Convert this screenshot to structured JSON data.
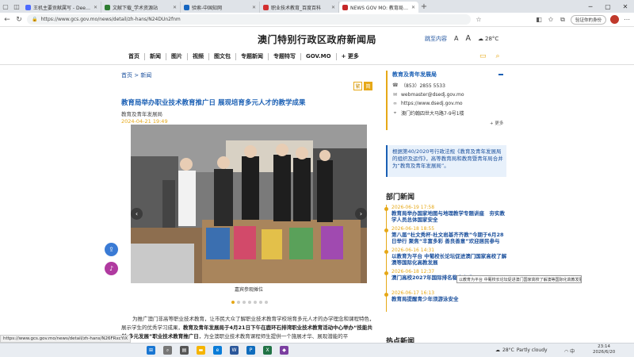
{
  "browser": {
    "tabs": [
      {
        "title": "王机主要贡献属写 - DeepSeek",
        "color": "#4d6bfe",
        "active": false
      },
      {
        "title": "文献下载_学术资源站",
        "color": "#2e7d32",
        "active": false
      },
      {
        "title": "验索-中国知网",
        "color": "#1565c0",
        "active": false
      },
      {
        "title": "职业技术教育_百度百科",
        "color": "#d32f2f",
        "active": false
      },
      {
        "title": "NEWS GOV MO: 教育局举办职业技术教育推广日",
        "color": "#c62828",
        "active": true
      }
    ],
    "url": "https://www.gcs.gov.mo/news/detail/zh-hans/N24DUn2fnm",
    "profile_label": "验证你的身份",
    "status_url": "https://www.gcs.gov.mo/news/detail/zh-hans/N26FRxcYiX"
  },
  "site": {
    "title": "澳门特别行政区政府新闻局",
    "skip_label": "跳至内容",
    "font_small": "A",
    "font_large": "A",
    "weather": "28°C"
  },
  "nav": {
    "items": [
      "首页",
      "新闻",
      "图片",
      "视频",
      "图文包",
      "专题新闻",
      "专题特写",
      "GOV.MO",
      "+ 更多"
    ]
  },
  "breadcrumb": {
    "home": "首页",
    "sep": ">",
    "current": "新闻"
  },
  "lang": {
    "trad": "繁",
    "simp": "简"
  },
  "article": {
    "title": "教育局举办职业技术教育推广日 展现培育多元人才的教学成果",
    "source": "教育及青年发展局",
    "date": "2024-04-21 19:49",
    "caption": "嘉宾参观摊位",
    "slide_count": 7,
    "active_slide": 0,
    "body_1": "为推广澳门非高等职业技术教育，让市民大众了解职业技术教育学校培育多元人才的办学理念和课程特色，展示学生的优秀学习成果，",
    "body_bold": "教育及青年发展局于4月21日下午在鹿环石排湾职业技术教育活动中心举办“技能共创·多元发展”职业技术教育推广日",
    "body_2": "，为全澳职业技术教育课程师生提供一个施展才华、展现潜能的平"
  },
  "contact": {
    "title": "教育及青年发展局",
    "phone": "（853）2855 5533",
    "email": "webmaster@dsedj.gov.mo",
    "website": "https://www.dsedj.gov.mo",
    "address": "澳门约翰四世大马路7-9号1楼",
    "more": "+ 更多"
  },
  "notice": "根据第40/2020号行政法规《教育及青年发展局的组织及运作》，高等教育局和教育暨青年局合并为“教育及青年发展局”。",
  "dept_news": {
    "title": "部门新闻",
    "items": [
      {
        "date": "2026-06-19 17:58",
        "text": "教育局举办国家地图与地理教学专题讲座　夯实教学人员总体国家安全"
      },
      {
        "date": "2026-06-18 18:55",
        "text": "第八届“杜文秀杯·杜文岩基齐齐教”今期于6月28日举行 聚焦“丰富多彩 善良善意”欢迎居民参与"
      },
      {
        "date": "2026-06-16 14:31",
        "text": "以教育为平台 中葡校长论坛促进澳门国家高校了解澳等国际化高教发展"
      },
      {
        "date": "2026-06-18 12:37",
        "text": "澳门高校2027年国际排名稳步上升"
      },
      {
        "date": "2026-06-17 16:13",
        "text": "教育局提醒青少年须游泳安全"
      }
    ]
  },
  "hot_news": {
    "title": "热点新闻"
  },
  "tooltip": "以教育为平台 中葡校长论坛促进澳门国家高校了解澳等国际化高教发展",
  "taskbar": {
    "weather_temp": "28°C",
    "weather_text": "Partly cloudy",
    "time": "23:14",
    "date": "2026/6/20",
    "tray_lang": "中"
  },
  "colors": {
    "accent": "#e6a817",
    "link": "#1a5fb4"
  }
}
